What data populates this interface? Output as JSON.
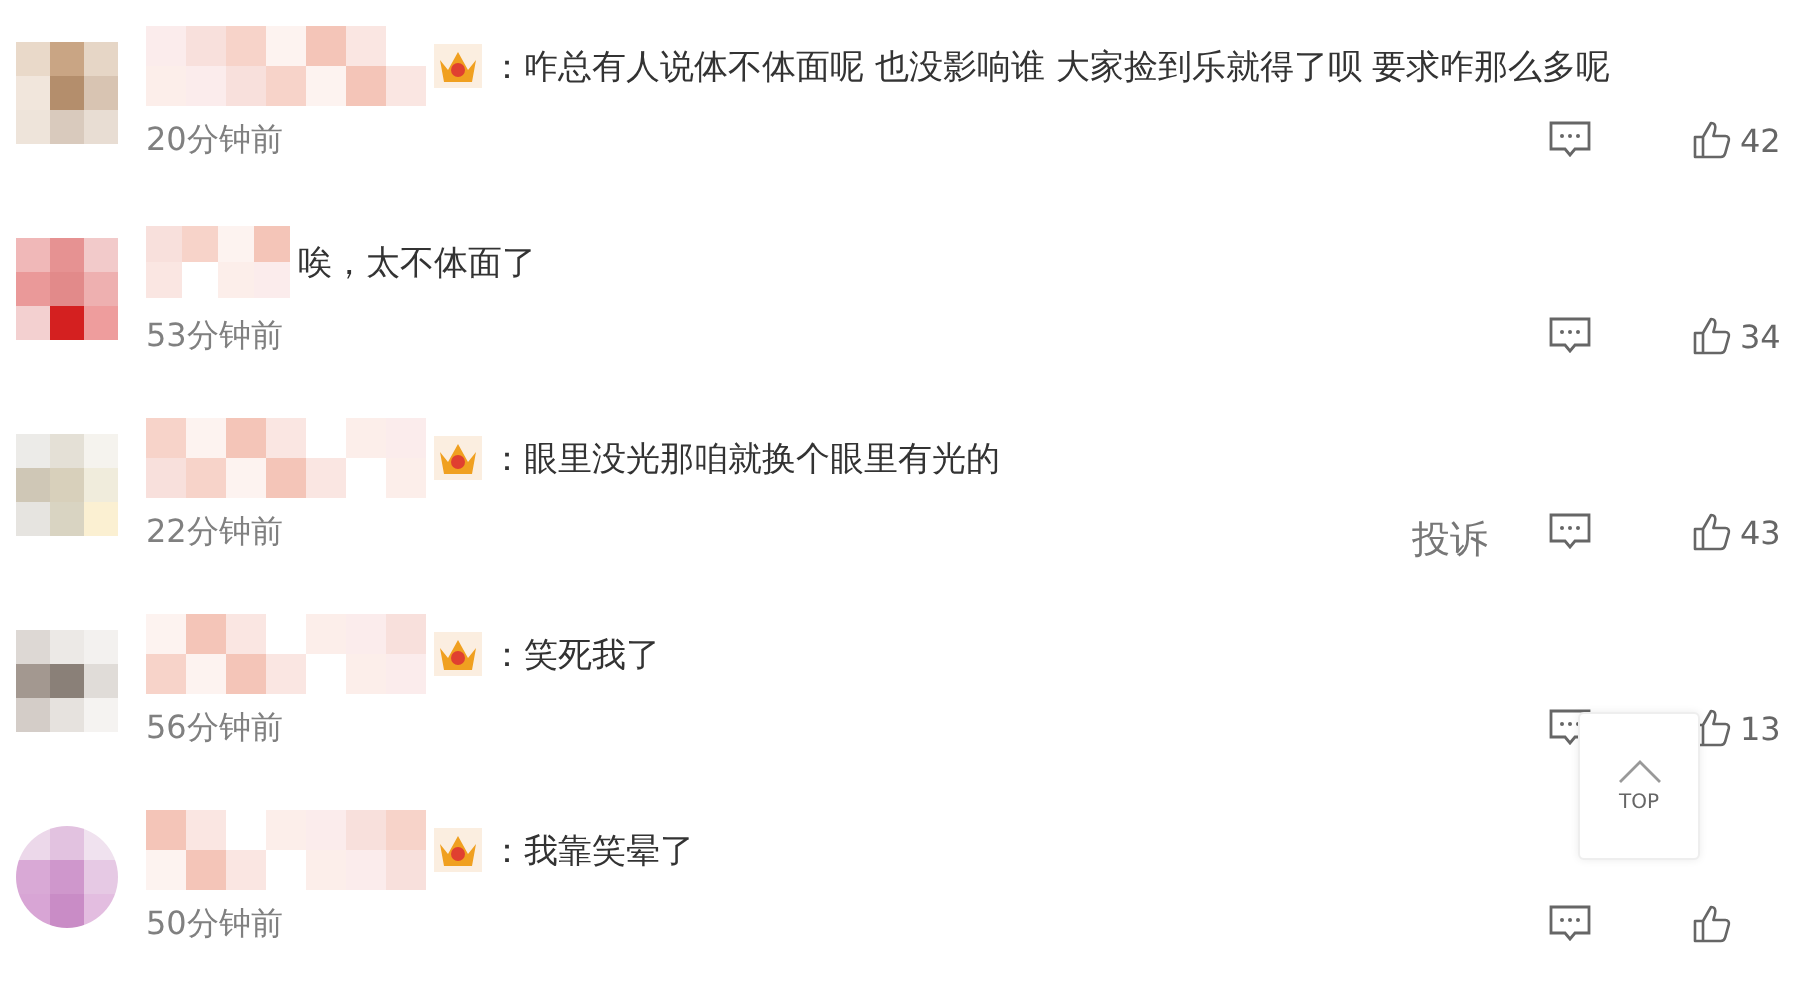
{
  "comments": [
    {
      "badge": true,
      "text": "：咋总有人说体不体面呢 也没影响谁 大家捡到乐就得了呗 要求咋那么多呢",
      "time": "20分钟前",
      "likes": "42"
    },
    {
      "badge": false,
      "text": "唉，太不体面了",
      "time": "53分钟前",
      "likes": "34"
    },
    {
      "badge": true,
      "text": "：眼里没光那咱就换个眼里有光的",
      "time": "22分钟前",
      "report": "投诉",
      "likes": "43"
    },
    {
      "badge": true,
      "text": "：笑死我了",
      "time": "56分钟前",
      "likes": "13"
    },
    {
      "badge": true,
      "text": "：我靠笑晕了",
      "time": "50分钟前"
    }
  ],
  "top_button": {
    "label": "TOP"
  }
}
